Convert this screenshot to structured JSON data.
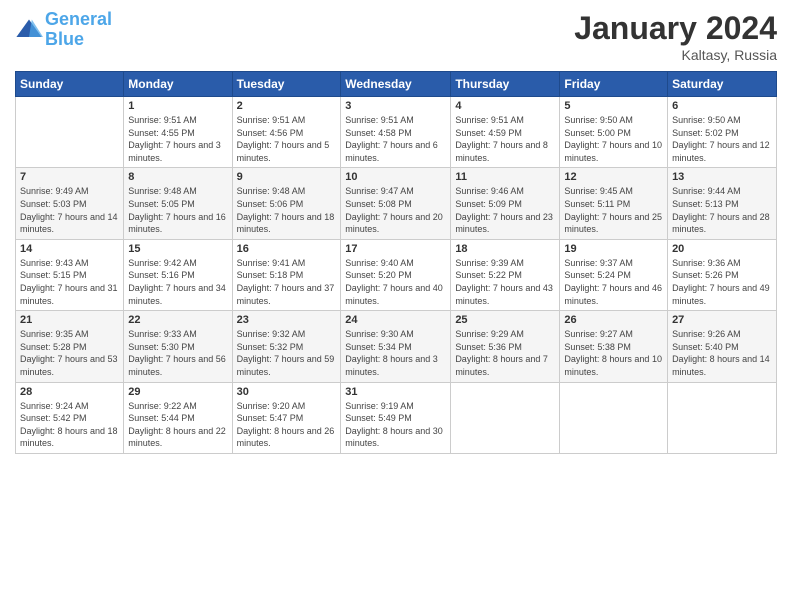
{
  "header": {
    "logo": {
      "line1": "General",
      "line2": "Blue"
    },
    "month_year": "January 2024",
    "location": "Kaltasy, Russia"
  },
  "weekdays": [
    "Sunday",
    "Monday",
    "Tuesday",
    "Wednesday",
    "Thursday",
    "Friday",
    "Saturday"
  ],
  "weeks": [
    [
      {
        "day": "",
        "sunrise": "",
        "sunset": "",
        "daylight": ""
      },
      {
        "day": "1",
        "sunrise": "Sunrise: 9:51 AM",
        "sunset": "Sunset: 4:55 PM",
        "daylight": "Daylight: 7 hours and 3 minutes."
      },
      {
        "day": "2",
        "sunrise": "Sunrise: 9:51 AM",
        "sunset": "Sunset: 4:56 PM",
        "daylight": "Daylight: 7 hours and 5 minutes."
      },
      {
        "day": "3",
        "sunrise": "Sunrise: 9:51 AM",
        "sunset": "Sunset: 4:58 PM",
        "daylight": "Daylight: 7 hours and 6 minutes."
      },
      {
        "day": "4",
        "sunrise": "Sunrise: 9:51 AM",
        "sunset": "Sunset: 4:59 PM",
        "daylight": "Daylight: 7 hours and 8 minutes."
      },
      {
        "day": "5",
        "sunrise": "Sunrise: 9:50 AM",
        "sunset": "Sunset: 5:00 PM",
        "daylight": "Daylight: 7 hours and 10 minutes."
      },
      {
        "day": "6",
        "sunrise": "Sunrise: 9:50 AM",
        "sunset": "Sunset: 5:02 PM",
        "daylight": "Daylight: 7 hours and 12 minutes."
      }
    ],
    [
      {
        "day": "7",
        "sunrise": "Sunrise: 9:49 AM",
        "sunset": "Sunset: 5:03 PM",
        "daylight": "Daylight: 7 hours and 14 minutes."
      },
      {
        "day": "8",
        "sunrise": "Sunrise: 9:48 AM",
        "sunset": "Sunset: 5:05 PM",
        "daylight": "Daylight: 7 hours and 16 minutes."
      },
      {
        "day": "9",
        "sunrise": "Sunrise: 9:48 AM",
        "sunset": "Sunset: 5:06 PM",
        "daylight": "Daylight: 7 hours and 18 minutes."
      },
      {
        "day": "10",
        "sunrise": "Sunrise: 9:47 AM",
        "sunset": "Sunset: 5:08 PM",
        "daylight": "Daylight: 7 hours and 20 minutes."
      },
      {
        "day": "11",
        "sunrise": "Sunrise: 9:46 AM",
        "sunset": "Sunset: 5:09 PM",
        "daylight": "Daylight: 7 hours and 23 minutes."
      },
      {
        "day": "12",
        "sunrise": "Sunrise: 9:45 AM",
        "sunset": "Sunset: 5:11 PM",
        "daylight": "Daylight: 7 hours and 25 minutes."
      },
      {
        "day": "13",
        "sunrise": "Sunrise: 9:44 AM",
        "sunset": "Sunset: 5:13 PM",
        "daylight": "Daylight: 7 hours and 28 minutes."
      }
    ],
    [
      {
        "day": "14",
        "sunrise": "Sunrise: 9:43 AM",
        "sunset": "Sunset: 5:15 PM",
        "daylight": "Daylight: 7 hours and 31 minutes."
      },
      {
        "day": "15",
        "sunrise": "Sunrise: 9:42 AM",
        "sunset": "Sunset: 5:16 PM",
        "daylight": "Daylight: 7 hours and 34 minutes."
      },
      {
        "day": "16",
        "sunrise": "Sunrise: 9:41 AM",
        "sunset": "Sunset: 5:18 PM",
        "daylight": "Daylight: 7 hours and 37 minutes."
      },
      {
        "day": "17",
        "sunrise": "Sunrise: 9:40 AM",
        "sunset": "Sunset: 5:20 PM",
        "daylight": "Daylight: 7 hours and 40 minutes."
      },
      {
        "day": "18",
        "sunrise": "Sunrise: 9:39 AM",
        "sunset": "Sunset: 5:22 PM",
        "daylight": "Daylight: 7 hours and 43 minutes."
      },
      {
        "day": "19",
        "sunrise": "Sunrise: 9:37 AM",
        "sunset": "Sunset: 5:24 PM",
        "daylight": "Daylight: 7 hours and 46 minutes."
      },
      {
        "day": "20",
        "sunrise": "Sunrise: 9:36 AM",
        "sunset": "Sunset: 5:26 PM",
        "daylight": "Daylight: 7 hours and 49 minutes."
      }
    ],
    [
      {
        "day": "21",
        "sunrise": "Sunrise: 9:35 AM",
        "sunset": "Sunset: 5:28 PM",
        "daylight": "Daylight: 7 hours and 53 minutes."
      },
      {
        "day": "22",
        "sunrise": "Sunrise: 9:33 AM",
        "sunset": "Sunset: 5:30 PM",
        "daylight": "Daylight: 7 hours and 56 minutes."
      },
      {
        "day": "23",
        "sunrise": "Sunrise: 9:32 AM",
        "sunset": "Sunset: 5:32 PM",
        "daylight": "Daylight: 7 hours and 59 minutes."
      },
      {
        "day": "24",
        "sunrise": "Sunrise: 9:30 AM",
        "sunset": "Sunset: 5:34 PM",
        "daylight": "Daylight: 8 hours and 3 minutes."
      },
      {
        "day": "25",
        "sunrise": "Sunrise: 9:29 AM",
        "sunset": "Sunset: 5:36 PM",
        "daylight": "Daylight: 8 hours and 7 minutes."
      },
      {
        "day": "26",
        "sunrise": "Sunrise: 9:27 AM",
        "sunset": "Sunset: 5:38 PM",
        "daylight": "Daylight: 8 hours and 10 minutes."
      },
      {
        "day": "27",
        "sunrise": "Sunrise: 9:26 AM",
        "sunset": "Sunset: 5:40 PM",
        "daylight": "Daylight: 8 hours and 14 minutes."
      }
    ],
    [
      {
        "day": "28",
        "sunrise": "Sunrise: 9:24 AM",
        "sunset": "Sunset: 5:42 PM",
        "daylight": "Daylight: 8 hours and 18 minutes."
      },
      {
        "day": "29",
        "sunrise": "Sunrise: 9:22 AM",
        "sunset": "Sunset: 5:44 PM",
        "daylight": "Daylight: 8 hours and 22 minutes."
      },
      {
        "day": "30",
        "sunrise": "Sunrise: 9:20 AM",
        "sunset": "Sunset: 5:47 PM",
        "daylight": "Daylight: 8 hours and 26 minutes."
      },
      {
        "day": "31",
        "sunrise": "Sunrise: 9:19 AM",
        "sunset": "Sunset: 5:49 PM",
        "daylight": "Daylight: 8 hours and 30 minutes."
      },
      {
        "day": "",
        "sunrise": "",
        "sunset": "",
        "daylight": ""
      },
      {
        "day": "",
        "sunrise": "",
        "sunset": "",
        "daylight": ""
      },
      {
        "day": "",
        "sunrise": "",
        "sunset": "",
        "daylight": ""
      }
    ]
  ]
}
